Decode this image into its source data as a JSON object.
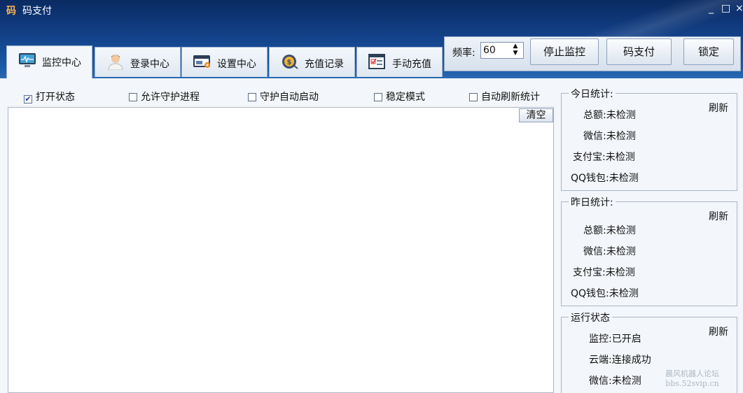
{
  "window": {
    "icon_text": "码",
    "title": "码支付",
    "min": "_",
    "max": "□",
    "close": "×"
  },
  "tabs": [
    {
      "label": "监控中心",
      "icon": "monitor-icon"
    },
    {
      "label": "登录中心",
      "icon": "user-icon"
    },
    {
      "label": "设置中心",
      "icon": "settings-window-icon"
    },
    {
      "label": "充值记录",
      "icon": "coin-icon"
    },
    {
      "label": "手动充值",
      "icon": "checklist-icon"
    }
  ],
  "toolbar": {
    "rate_label": "频率:",
    "rate_value": "60",
    "stop_label": "停止监控",
    "pay_label": "码支付",
    "lock_label": "锁定"
  },
  "options": [
    {
      "label": "打开状态",
      "checked": true
    },
    {
      "label": "允许守护进程",
      "checked": false
    },
    {
      "label": "守护自动启动",
      "checked": false
    },
    {
      "label": "稳定模式",
      "checked": false
    },
    {
      "label": "自动刷新统计",
      "checked": false
    }
  ],
  "log": {
    "clear_label": "清空"
  },
  "today": {
    "title": "今日统计:",
    "refresh": "刷新",
    "rows": [
      "总额:未检测",
      "微信:未检测",
      "支付宝:未检测",
      "QQ钱包:未检测"
    ]
  },
  "yesterday": {
    "title": "昨日统计:",
    "refresh": "刷新",
    "rows": [
      "总额:未检测",
      "微信:未检测",
      "支付宝:未检测",
      "QQ钱包:未检测"
    ]
  },
  "status": {
    "title": "运行状态",
    "refresh": "刷新",
    "rows": [
      "监控:已开启",
      "云端:连接成功",
      "微信:未检测"
    ]
  },
  "watermark": {
    "line1": "晨风机器人论坛",
    "line2": "bbs.52svip.cn"
  }
}
